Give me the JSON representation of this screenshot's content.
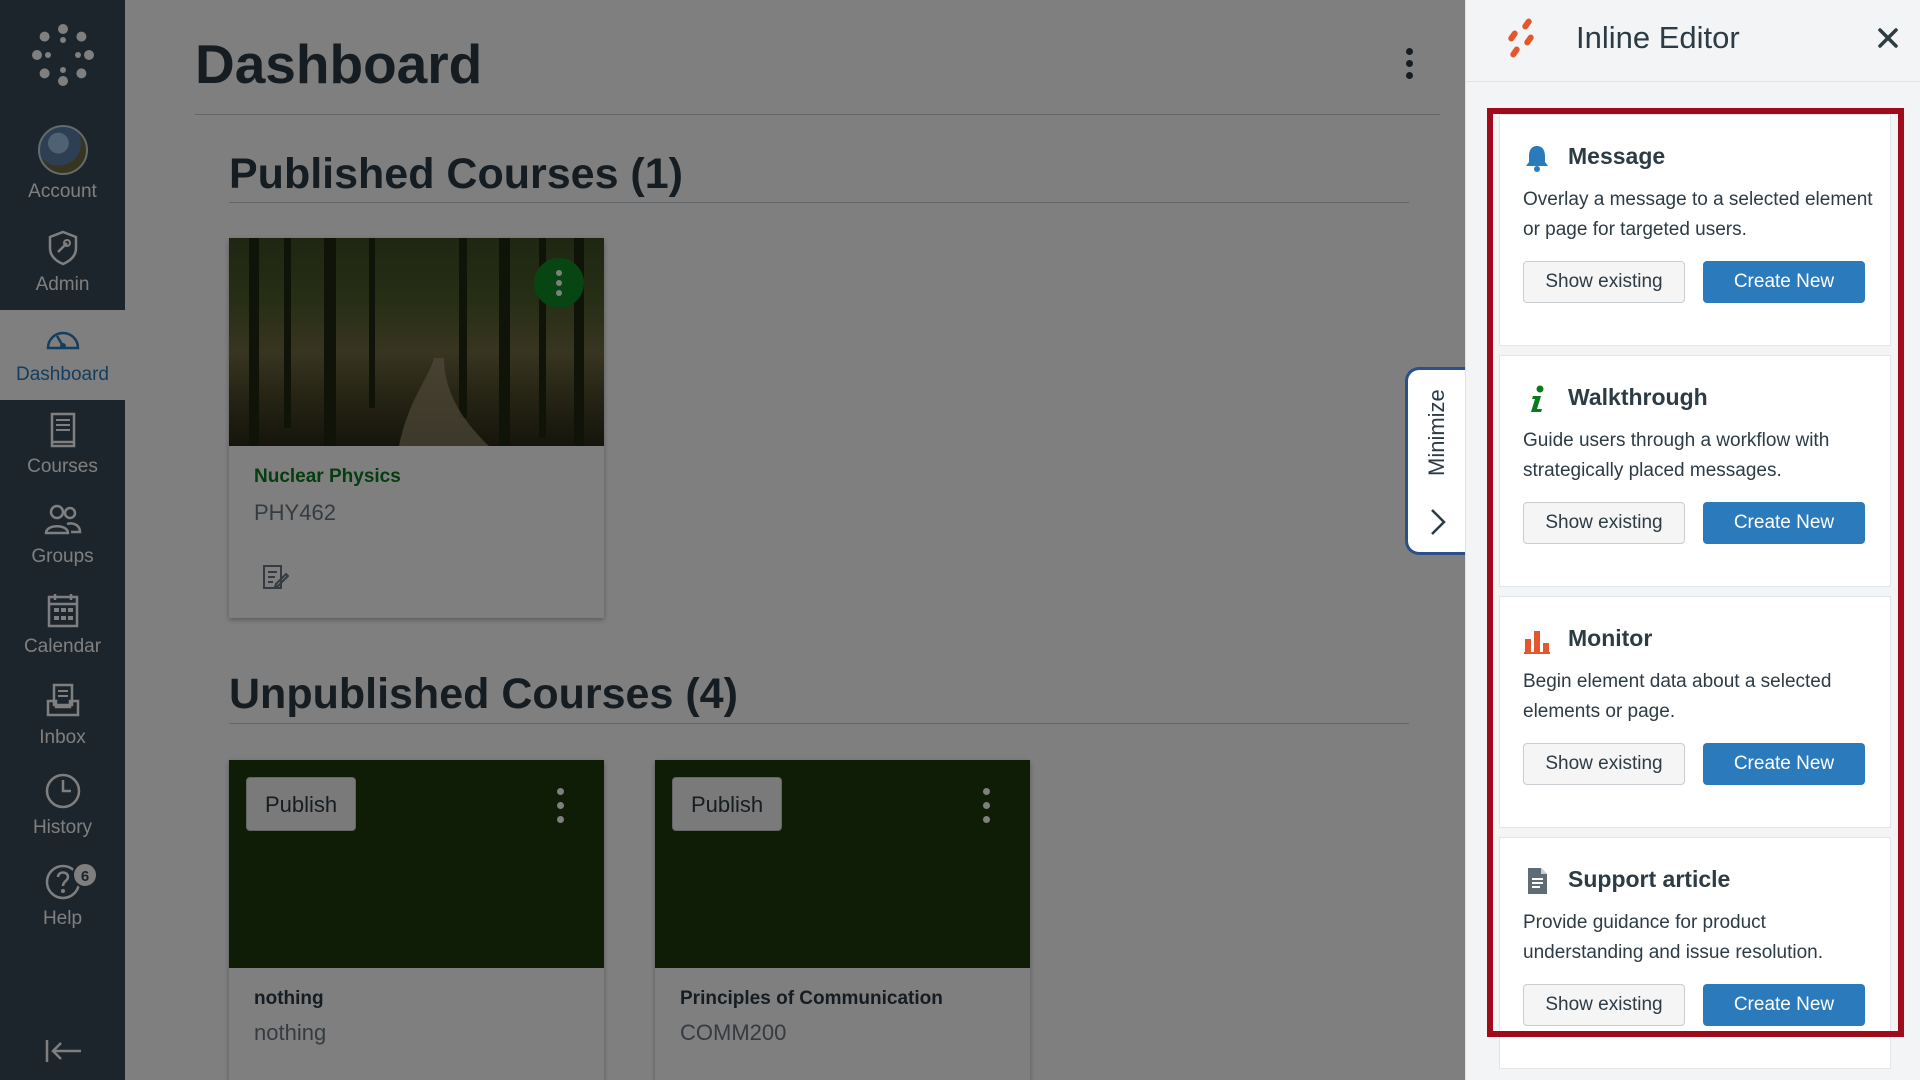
{
  "nav": {
    "items": [
      {
        "label": "Account",
        "icon": "account-avatar"
      },
      {
        "label": "Admin",
        "icon": "shield-icon"
      },
      {
        "label": "Dashboard",
        "icon": "dashboard-gauge-icon"
      },
      {
        "label": "Courses",
        "icon": "book-icon"
      },
      {
        "label": "Groups",
        "icon": "people-icon"
      },
      {
        "label": "Calendar",
        "icon": "calendar-icon"
      },
      {
        "label": "Inbox",
        "icon": "inbox-icon"
      },
      {
        "label": "History",
        "icon": "clock-icon"
      },
      {
        "label": "Help",
        "icon": "help-icon",
        "badge": "6"
      }
    ],
    "active": "Dashboard"
  },
  "dashboard": {
    "title": "Dashboard",
    "published_heading": "Published Courses (1)",
    "unpublished_heading": "Unpublished Courses (4)"
  },
  "published_courses": [
    {
      "name": "Nuclear Physics",
      "code": "PHY462",
      "name_color": "#0b7a1f"
    }
  ],
  "unpublished_courses": [
    {
      "name": "nothing",
      "code": "nothing",
      "publish_label": "Publish"
    },
    {
      "name": "Principles of Communication",
      "code": "COMM200",
      "publish_label": "Publish"
    }
  ],
  "minimize_tab": {
    "label": "Minimize"
  },
  "panel": {
    "title": "Inline Editor",
    "features": [
      {
        "title": "Message",
        "icon": "bell-icon",
        "description": "Overlay a message to a selected element or page for targeted users.",
        "show_label": "Show existing",
        "create_label": "Create New"
      },
      {
        "title": "Walkthrough",
        "icon": "info-icon",
        "description": "Guide users through a workflow with strategically placed messages.",
        "show_label": "Show existing",
        "create_label": "Create New"
      },
      {
        "title": "Monitor",
        "icon": "bar-chart-icon",
        "description": "Begin element data about a selected elements or page.",
        "show_label": "Show existing",
        "create_label": "Create New"
      },
      {
        "title": "Support article",
        "icon": "document-icon",
        "description": "Provide guidance for product understanding and issue resolution.",
        "show_label": "Show existing",
        "create_label": "Create New"
      }
    ]
  },
  "colors": {
    "nav_bg": "#394b58",
    "accent_blue": "#2b7abc",
    "highlight_red": "#a00b1c",
    "course_green": "#0b7a1f"
  }
}
